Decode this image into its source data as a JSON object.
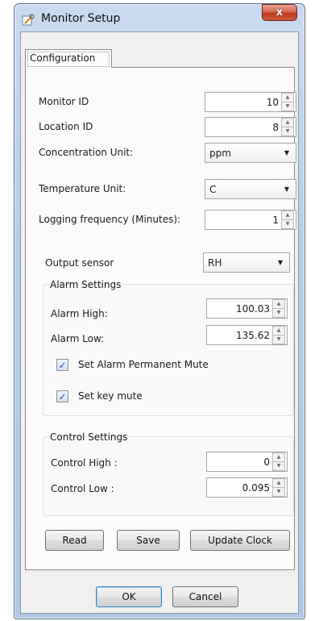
{
  "window": {
    "title": "Monitor Setup",
    "close_label": "x"
  },
  "tabs": [
    {
      "label": "Configuration",
      "selected": true
    }
  ],
  "config": {
    "monitor_id": {
      "label": "Monitor ID",
      "value": "10"
    },
    "location_id": {
      "label": "Location ID",
      "value": "8"
    },
    "concentration_unit": {
      "label": "Concentration Unit:",
      "value": "ppm"
    },
    "temperature_unit": {
      "label": "Temperature Unit:",
      "value": "C"
    },
    "logging_frequency": {
      "label": "Logging frequency (Minutes):",
      "value": "1"
    },
    "output_sensor": {
      "label": "Output sensor",
      "value": "RH"
    }
  },
  "alarm_settings": {
    "title": "Alarm Settings",
    "high": {
      "label": "Alarm High:",
      "value": "100.03"
    },
    "low": {
      "label": "Alarm Low:",
      "value": "135.62"
    },
    "permanent_mute": {
      "label": "Set Alarm Permanent Mute",
      "checked": true
    },
    "key_mute": {
      "label": "Set key mute",
      "checked": true
    }
  },
  "control_settings": {
    "title": "Control Settings",
    "high": {
      "label": "Control High :",
      "value": "0"
    },
    "low": {
      "label": "Control Low :",
      "value": "0.095"
    }
  },
  "actions": {
    "read": "Read",
    "save": "Save",
    "update_clock": "Update Clock"
  },
  "dialog_buttons": {
    "ok": "OK",
    "cancel": "Cancel"
  },
  "colors": {
    "frame": "#b7cce7",
    "close_button": "#c0391f",
    "checkbox_mark": "#2e4f8c"
  },
  "icons": {
    "window_icon": "wrench-icon",
    "check_mark": "✓",
    "spin_up": "▲",
    "spin_down": "▼",
    "combo_arrow": "▼"
  }
}
